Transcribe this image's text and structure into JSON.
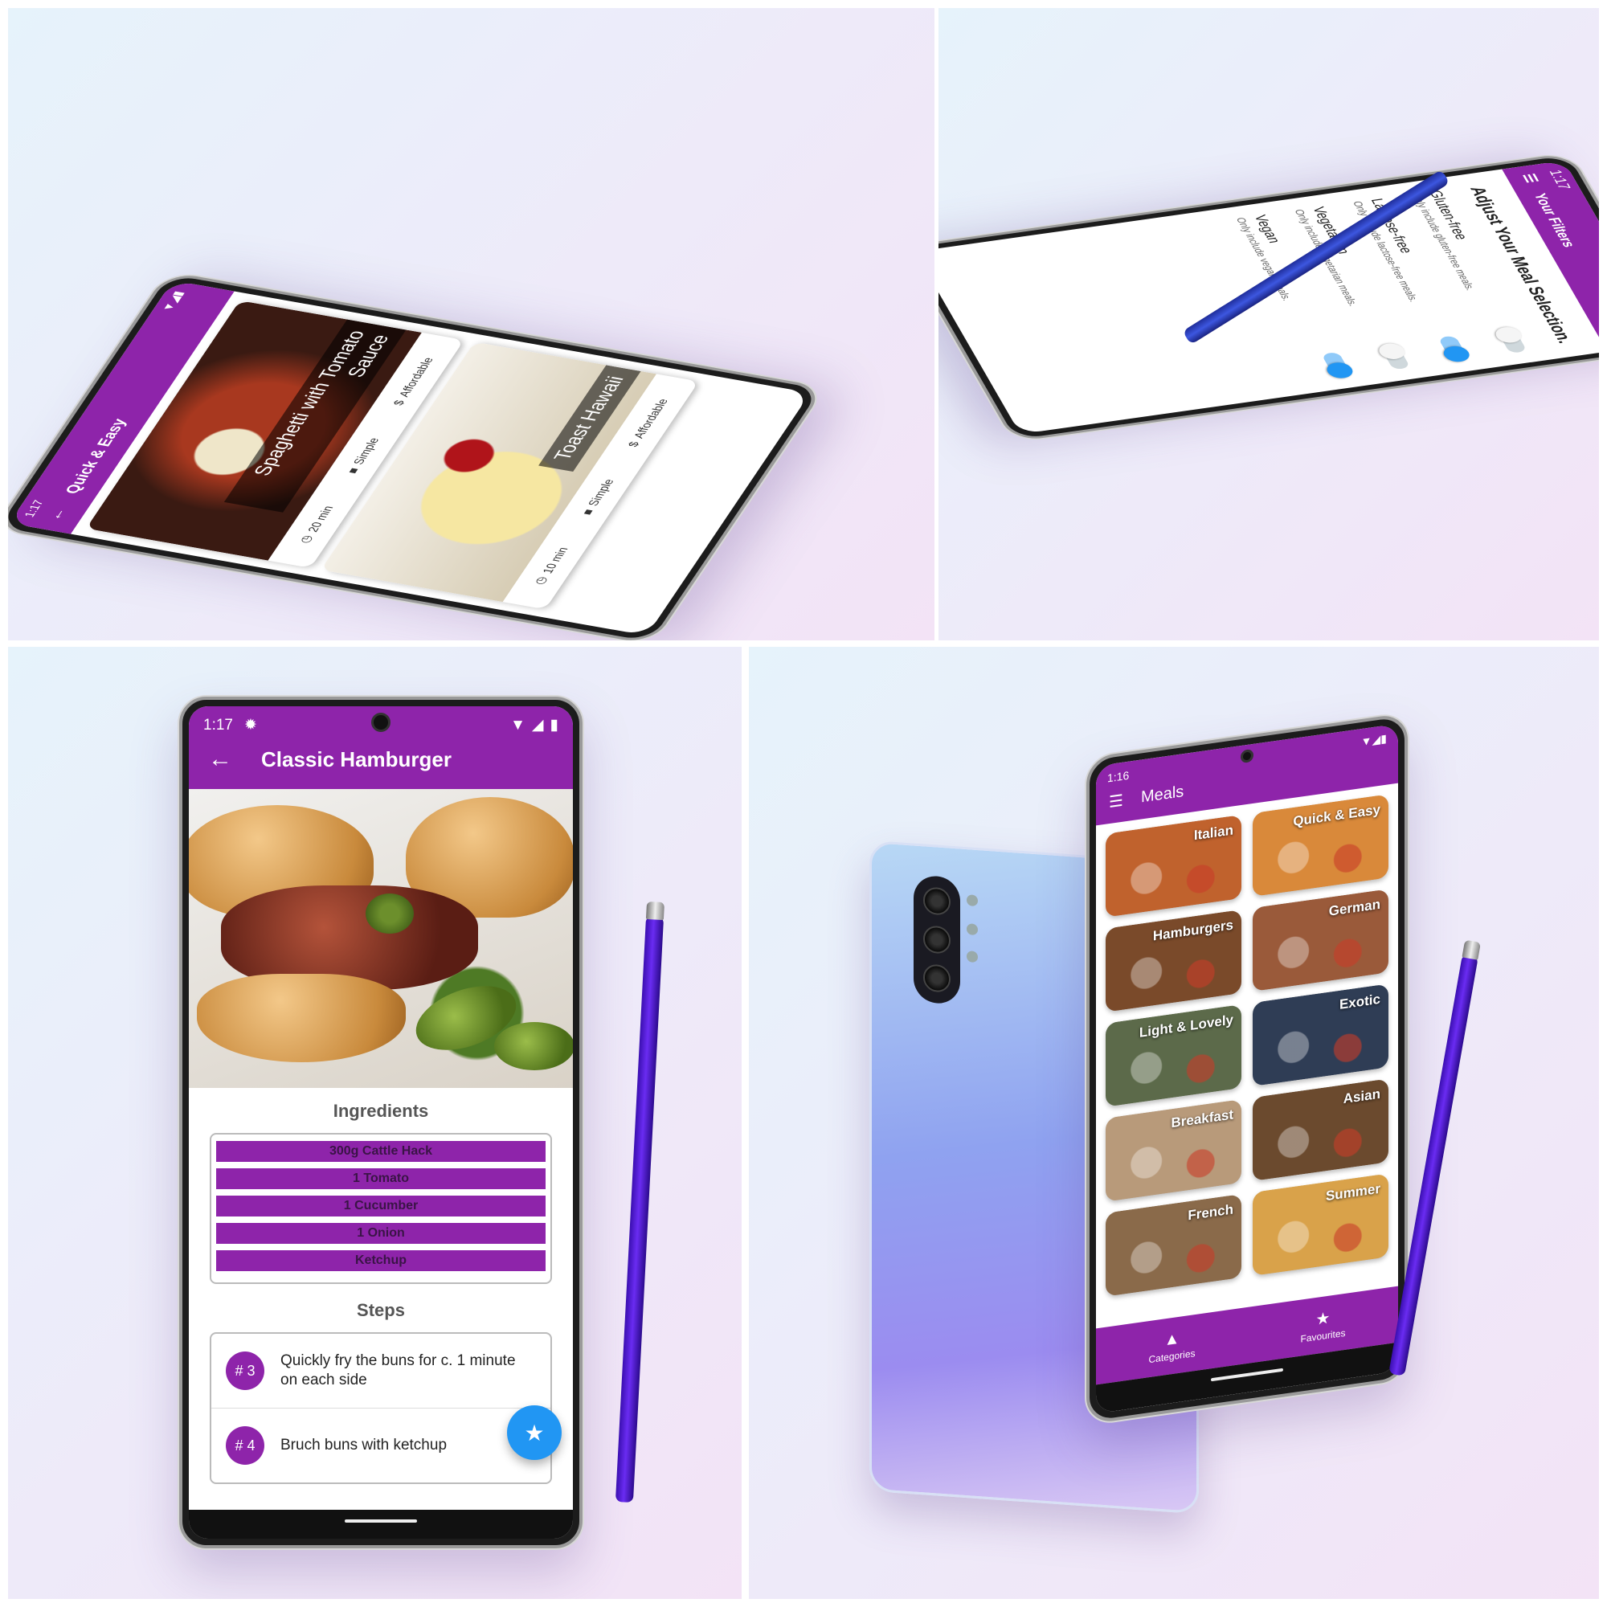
{
  "theme": {
    "primary": "#8e24aa",
    "accent": "#2196f3",
    "pen": "#5b24e0"
  },
  "hamburger_screen": {
    "status": {
      "time": "1:17",
      "settings_icon": "gear-icon",
      "signal_icons": "wifi-icon, signal-icon, battery-icon"
    },
    "back_icon": "arrow-back-icon",
    "title": "Classic Hamburger",
    "ingredients_title": "Ingredients",
    "ingredients": [
      "300g Cattle Hack",
      "1 Tomato",
      "1 Cucumber",
      "1 Onion",
      "Ketchup"
    ],
    "steps_title": "Steps",
    "steps": [
      {
        "num": "# 3",
        "text": "Quickly fry the buns for c. 1 minute on each side"
      },
      {
        "num": "# 4",
        "text": "Bruch buns with ketchup"
      }
    ],
    "fab_icon": "star-icon"
  },
  "meals_screen": {
    "status": {
      "time": "1:16"
    },
    "menu_icon": "menu-icon",
    "title": "Meals",
    "categories": [
      {
        "label": "Italian",
        "color": "#c0622d"
      },
      {
        "label": "Quick & Easy",
        "color": "#d9893a"
      },
      {
        "label": "Hamburgers",
        "color": "#7a4a2a"
      },
      {
        "label": "German",
        "color": "#9a5a3a"
      },
      {
        "label": "Light & Lovely",
        "color": "#5c6a4a"
      },
      {
        "label": "Exotic",
        "color": "#2f3d55"
      },
      {
        "label": "Breakfast",
        "color": "#b89a7a"
      },
      {
        "label": "Asian",
        "color": "#6b4a2e"
      },
      {
        "label": "French",
        "color": "#8a6a4a"
      },
      {
        "label": "Summer",
        "color": "#d9a24a"
      }
    ],
    "nav": [
      {
        "label": "Categories",
        "icon": "categories-icon"
      },
      {
        "label": "Favourites",
        "icon": "star-icon"
      }
    ]
  },
  "quick_screen": {
    "status": {
      "time": "1:17"
    },
    "back_icon": "arrow-back-icon",
    "title": "Quick & Easy",
    "meals": [
      {
        "title": "Spaghetti with Tomato Sauce",
        "duration": "20 min",
        "complexity": "Simple",
        "affordability": "Affordable",
        "color": "#7a2a1a"
      },
      {
        "title": "Toast Hawaii",
        "duration": "10 min",
        "complexity": "Simple",
        "affordability": "Affordable",
        "color": "#e9d78a"
      }
    ]
  },
  "filters_screen": {
    "status": {
      "time": "1:17"
    },
    "menu_icon": "menu-icon",
    "title": "Your Filters",
    "heading": "Adjust Your Meal Selection.",
    "filters": [
      {
        "title": "Gluten-free",
        "subtitle": "Only include gluten-free meals.",
        "on": false
      },
      {
        "title": "Lactose-free",
        "subtitle": "Only include lactose-free meals.",
        "on": true
      },
      {
        "title": "Vegetarian",
        "subtitle": "Only include vegetarian meals.",
        "on": false
      },
      {
        "title": "Vegan",
        "subtitle": "Only include vegan meals.",
        "on": true
      }
    ]
  }
}
